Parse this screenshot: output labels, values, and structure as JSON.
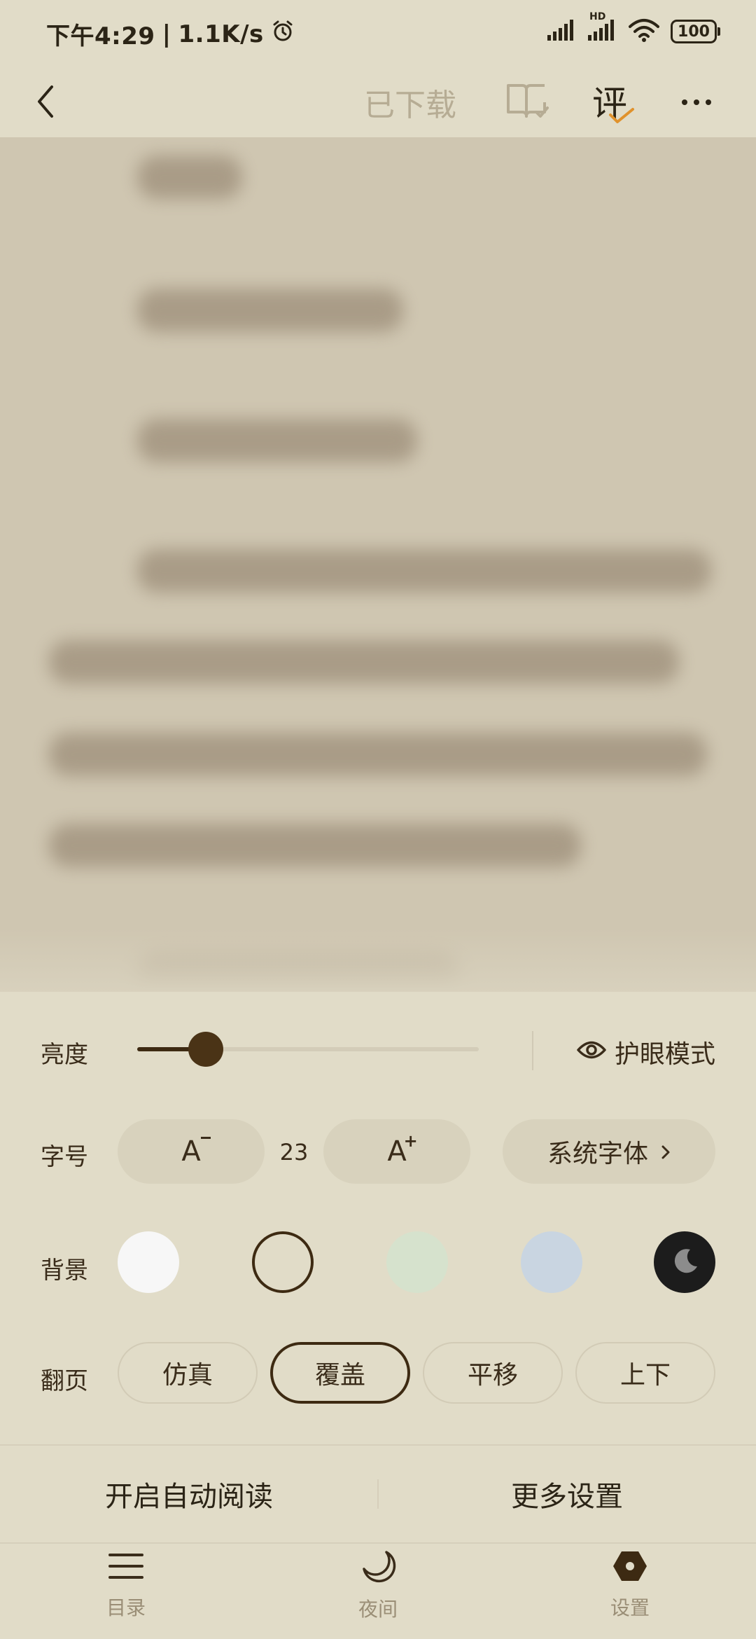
{
  "status_bar": {
    "time": "下午4:29",
    "speed": "1.1K/s",
    "hd_label": "HD",
    "battery": "100"
  },
  "toolbar": {
    "downloaded_label": "已下载",
    "review_label": "评"
  },
  "settings": {
    "brightness": {
      "label": "亮度",
      "level_percent": 20
    },
    "eye_mode_label": "护眼模式",
    "font_size": {
      "label": "字号",
      "decrease_label": "A",
      "increase_label": "A",
      "value": "23",
      "font_family_label": "系统字体"
    },
    "background": {
      "label": "背景",
      "options": [
        {
          "name": "white",
          "color": "#f7f7f7"
        },
        {
          "name": "parchment",
          "color": "#e1dcc8",
          "selected": true
        },
        {
          "name": "green",
          "color": "#d6e2cd"
        },
        {
          "name": "blue",
          "color": "#c9d5e1"
        },
        {
          "name": "night",
          "color": "#1c1c1c"
        }
      ]
    },
    "page_turn": {
      "label": "翻页",
      "options": [
        "仿真",
        "覆盖",
        "平移",
        "上下"
      ],
      "selected": "覆盖"
    }
  },
  "actions": {
    "auto_read_label": "开启自动阅读",
    "more_settings_label": "更多设置"
  },
  "bottom_nav": {
    "toc_label": "目录",
    "night_label": "夜间",
    "settings_label": "设置"
  },
  "colors": {
    "accent": "#e0922c",
    "primary_dark": "#3d2a12",
    "panel_bg": "#e1dcc8"
  }
}
